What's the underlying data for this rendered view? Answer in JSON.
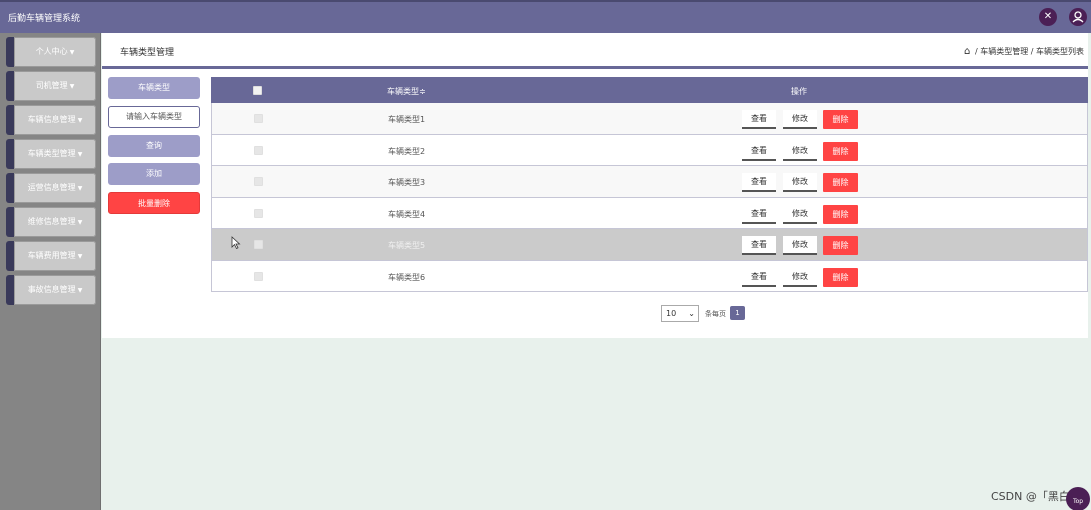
{
  "app": {
    "title": "后勤车辆管理系统"
  },
  "header_icons": [
    "settings-cross-icon",
    "user-icon"
  ],
  "sidebar": {
    "items": [
      {
        "label": "个人中心"
      },
      {
        "label": "司机管理"
      },
      {
        "label": "车辆信息管理"
      },
      {
        "label": "车辆类型管理"
      },
      {
        "label": "运营信息管理"
      },
      {
        "label": "维修信息管理"
      },
      {
        "label": "车辆费用管理"
      },
      {
        "label": "事故信息管理"
      }
    ]
  },
  "page": {
    "title": "车辆类型管理",
    "breadcrumb": [
      "车辆类型管理",
      "车辆类型列表"
    ],
    "breadcrumb_sep": "/"
  },
  "form": {
    "field_label": "车辆类型",
    "input_placeholder": "请输入车辆类型",
    "query_label": "查询",
    "add_label": "添加",
    "batch_delete_label": "批量删除"
  },
  "table": {
    "columns": [
      "车辆类型≑",
      "操作"
    ],
    "rows": [
      {
        "name": "车辆类型1"
      },
      {
        "name": "车辆类型2"
      },
      {
        "name": "车辆类型3"
      },
      {
        "name": "车辆类型4"
      },
      {
        "name": "车辆类型5"
      },
      {
        "name": "车辆类型6"
      }
    ],
    "actions": {
      "view": "查看",
      "edit": "修改",
      "delete": "删除"
    }
  },
  "pagination": {
    "page_size": "10",
    "per_page_label": "条每页",
    "current_page": "1"
  },
  "watermark": "CSDN @「黑白",
  "back_to_top": "Top",
  "colors": {
    "accent": "#686897",
    "danger": "#ff4444",
    "sidebar_bg": "#858585",
    "content_bg": "#e8f1ec"
  }
}
